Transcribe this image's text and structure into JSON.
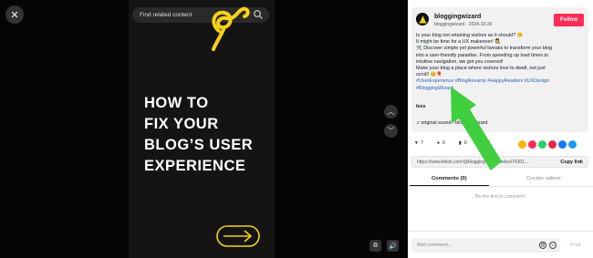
{
  "video": {
    "search_placeholder": "Find related content",
    "headline_lines": [
      "HOW TO",
      "FIX YOUR",
      "BLOG’S USER",
      "EXPERIENCE"
    ],
    "accent_yellow": "#f7d117"
  },
  "post": {
    "username": "bloggingwizard",
    "subline": "bloggingwizard · 2024-10-26",
    "follow_label": "Follow",
    "desc_lines": [
      "Is your blog not retaining visitors as it should? 😕",
      "It might be time for a UX makeover! 👩‍🎨",
      "🛠️ Discover simple yet powerful tweaks to transform your blog",
      "into a user-friendly paradise. From speeding up load times to",
      "intuitive navigation, we got you covered!",
      "Make your blog a place where visitors love to dwell, not just",
      "scroll! 😊🎈"
    ],
    "tags_line1": "#UserExperience #BlogRevamp #HappyReaders #UXDesign",
    "tags_line2": "#BloggingWizard",
    "less_label": "less",
    "sound": "original sound - bloggingwizard",
    "brand_color": "#fe2c55"
  },
  "actions": {
    "likes": "7",
    "comments": "0",
    "saves": "0",
    "reposts": "0"
  },
  "link": {
    "url": "https://www.tiktok.com/@bloggingwizard/video/74301...",
    "copy_label": "Copy link"
  },
  "tabs": {
    "comments": "Comments (0)",
    "creator": "Creator videos"
  },
  "empty_comments": "Be the first to comment!",
  "comment_bar": {
    "placeholder": "Add comment...",
    "post_label": "Post"
  }
}
